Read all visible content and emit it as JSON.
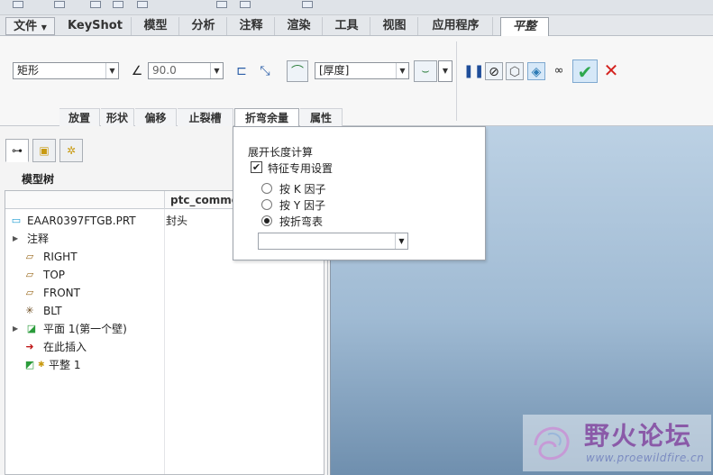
{
  "menu_tabs": {
    "file": "文件",
    "keyshot": "KeyShot",
    "model": "模型",
    "analysis": "分析",
    "annotate": "注释",
    "render": "渲染",
    "tools": "工具",
    "view": "视图",
    "apps": "应用程序",
    "flatten": "平整"
  },
  "ribbon": {
    "shape_select": "矩形",
    "angle_value": "90.0",
    "thickness_select": "[厚度]"
  },
  "subtabs": {
    "placement": "放置",
    "shape": "形状",
    "offset": "偏移",
    "relief": "止裂槽",
    "bend_allowance": "折弯余量",
    "properties": "属性"
  },
  "popup": {
    "heading": "展开长度计算",
    "feature_specific": "特征专用设置",
    "k_factor": "按 K 因子",
    "y_factor": "按 Y 因子",
    "bend_table": "按折弯表",
    "dropdown_value": ""
  },
  "tree": {
    "title": "模型树",
    "column2": "ptc_common_name",
    "rows": [
      {
        "label": "EAAR0397FTGB.PRT",
        "col2": "封头"
      },
      {
        "label": "注释",
        "col2": ""
      },
      {
        "label": "RIGHT",
        "col2": ""
      },
      {
        "label": "TOP",
        "col2": ""
      },
      {
        "label": "FRONT",
        "col2": ""
      },
      {
        "label": "BLT",
        "col2": ""
      },
      {
        "label": "平面 1(第一个壁)",
        "col2": ""
      },
      {
        "label": "在此插入",
        "col2": ""
      },
      {
        "label": "平整 1",
        "col2": ""
      }
    ]
  },
  "watermark": {
    "name": "野火论坛",
    "url": "www.proewildfire.cn"
  },
  "colors": {
    "confirm": "#2fa84f",
    "cancel": "#d4231f",
    "insert_arrow": "#c0191a"
  }
}
